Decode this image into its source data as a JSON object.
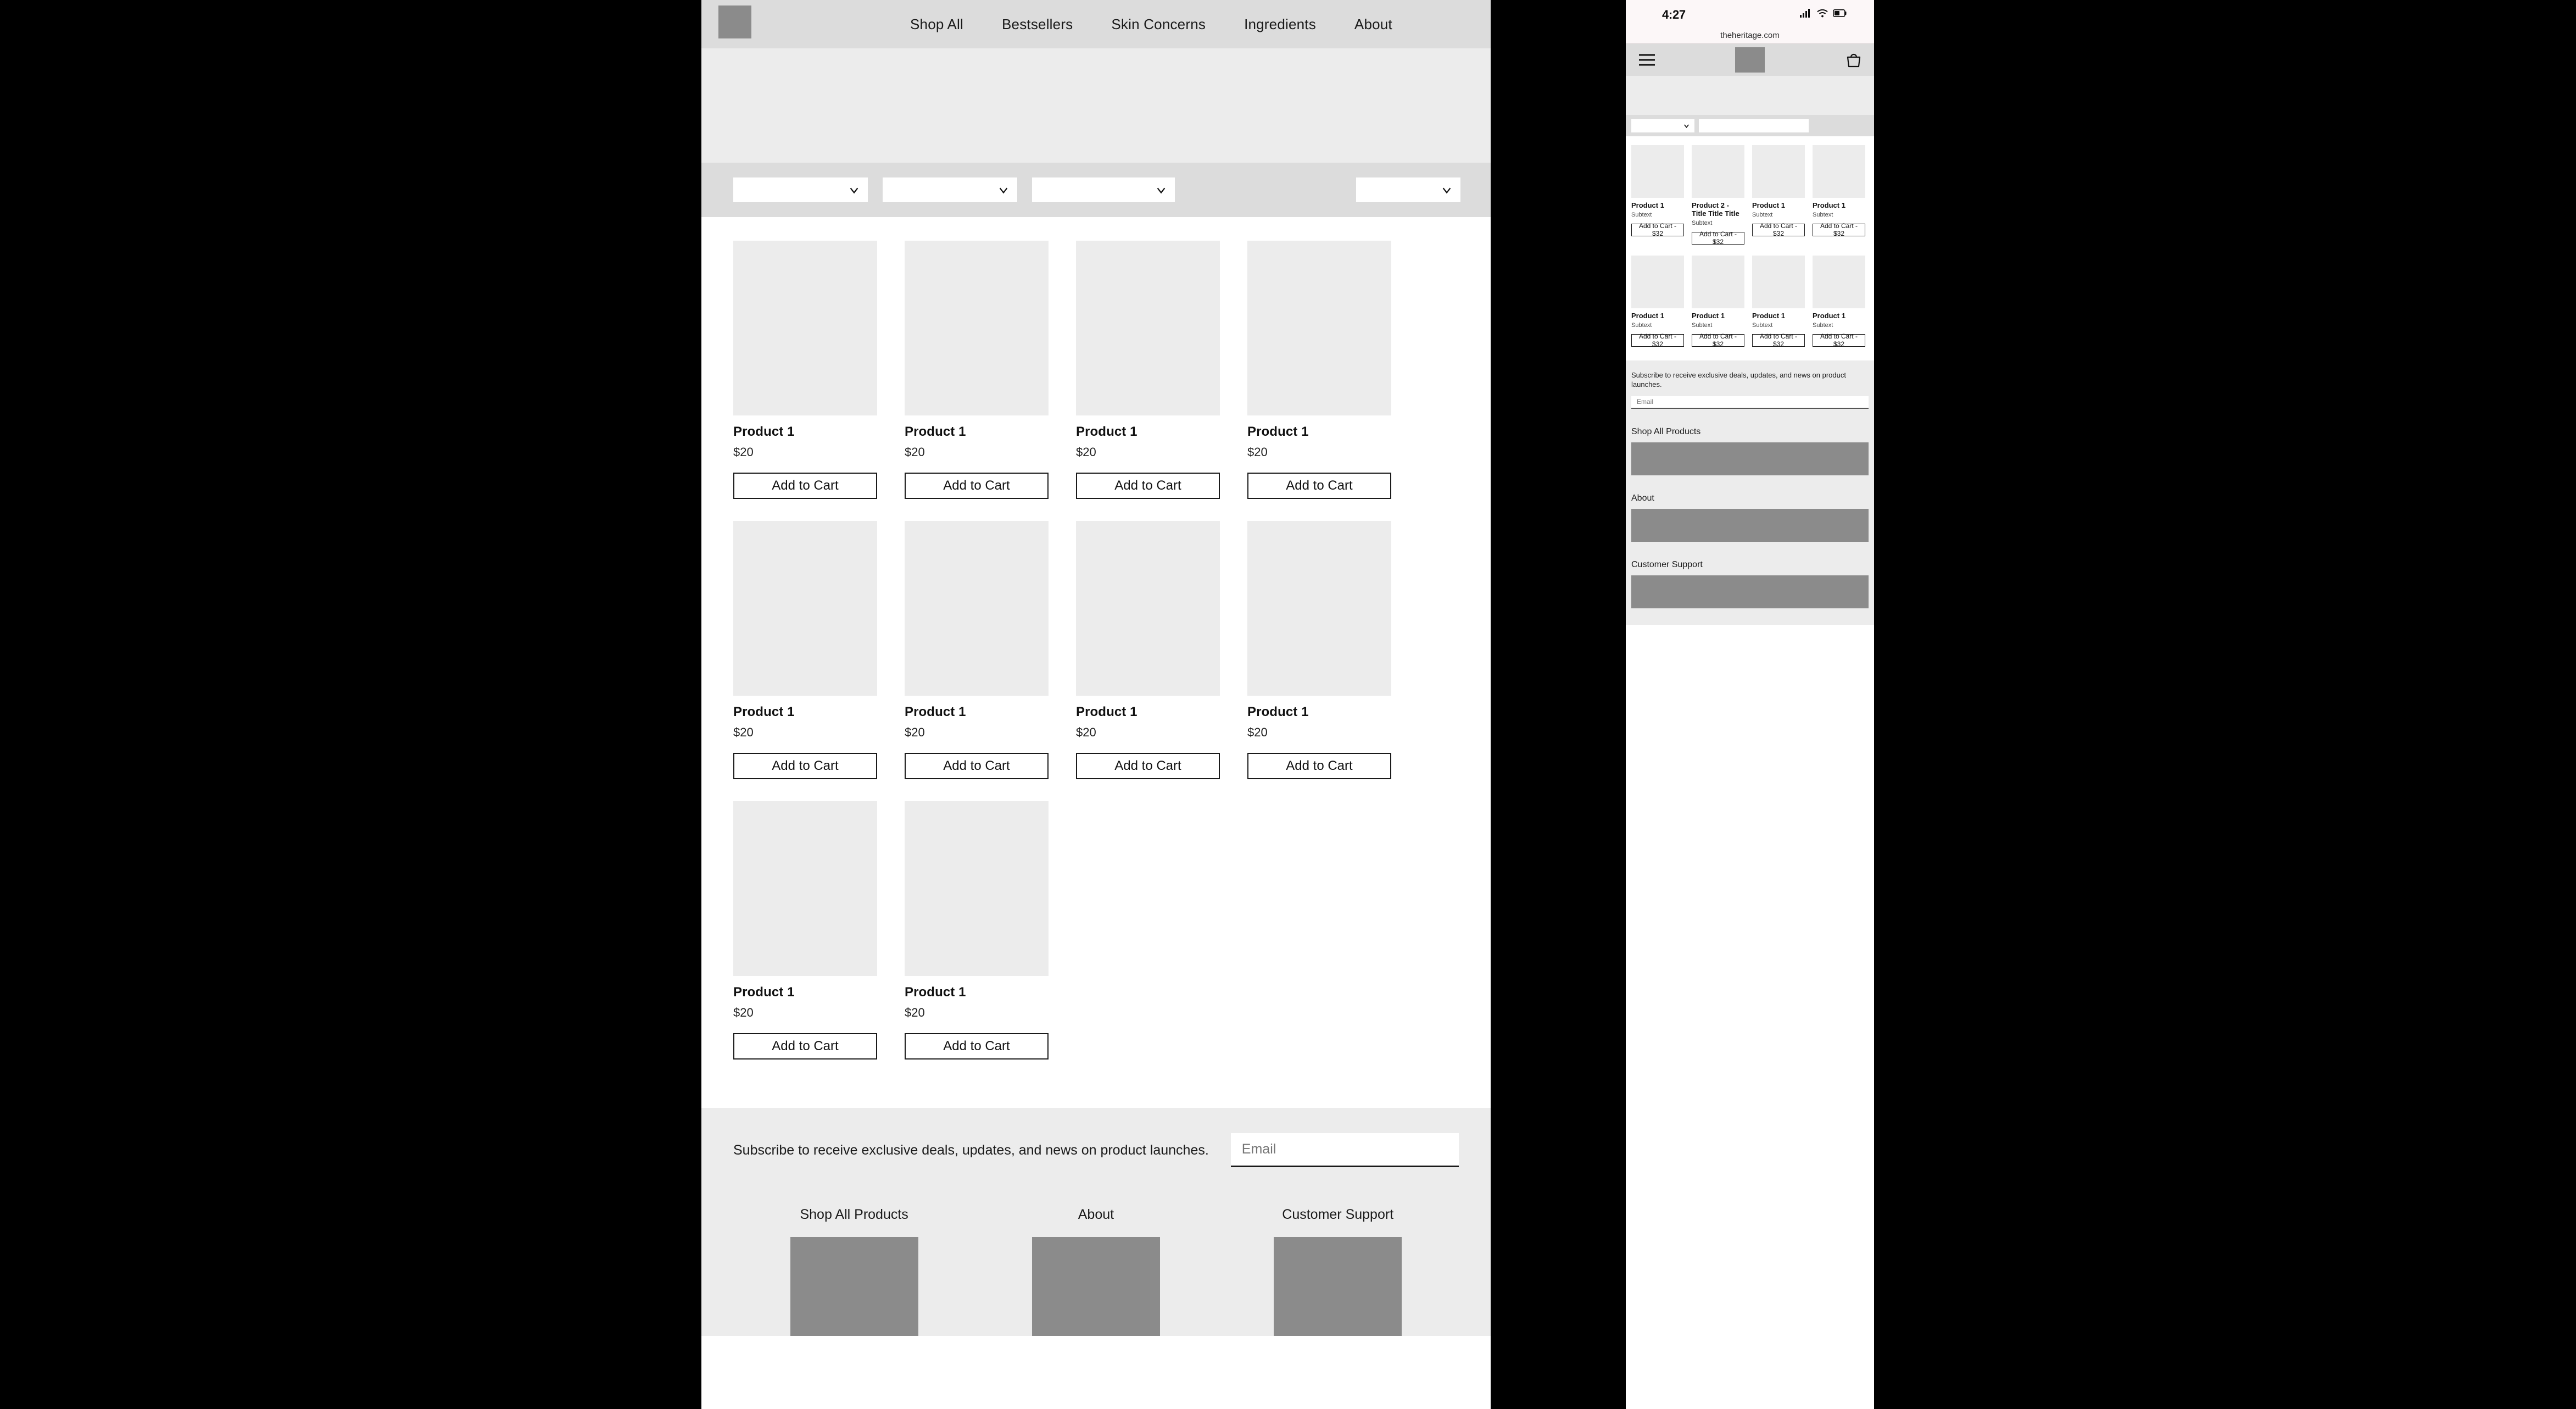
{
  "desktop": {
    "nav": {
      "logo_label": "logo-placeholder",
      "links": [
        {
          "label": "Shop All"
        },
        {
          "label": "Bestsellers"
        },
        {
          "label": "Skin Concerns"
        },
        {
          "label": "Ingredients"
        },
        {
          "label": "About"
        }
      ]
    },
    "filters": [
      {
        "value": "",
        "placeholder": ""
      },
      {
        "value": "",
        "placeholder": ""
      },
      {
        "value": "",
        "placeholder": ""
      },
      {
        "value": "",
        "placeholder": ""
      }
    ],
    "products": [
      {
        "title": "Product 1",
        "price": "$20",
        "cta": "Add to Cart"
      },
      {
        "title": "Product 1",
        "price": "$20",
        "cta": "Add to Cart"
      },
      {
        "title": "Product 1",
        "price": "$20",
        "cta": "Add to Cart"
      },
      {
        "title": "Product 1",
        "price": "$20",
        "cta": "Add to Cart"
      },
      {
        "title": "Product 1",
        "price": "$20",
        "cta": "Add to Cart"
      },
      {
        "title": "Product 1",
        "price": "$20",
        "cta": "Add to Cart"
      },
      {
        "title": "Product 1",
        "price": "$20",
        "cta": "Add to Cart"
      },
      {
        "title": "Product 1",
        "price": "$20",
        "cta": "Add to Cart"
      },
      {
        "title": "Product 1",
        "price": "$20",
        "cta": "Add to Cart"
      },
      {
        "title": "Product 1",
        "price": "$20",
        "cta": "Add to Cart"
      }
    ],
    "footer": {
      "subscribe_text": "Subscribe to receive exclusive deals, updates, and news on product launches.",
      "email_placeholder": "Email",
      "email_value": "",
      "columns": [
        {
          "heading": "Shop All Products"
        },
        {
          "heading": "About"
        },
        {
          "heading": "Customer Support"
        }
      ]
    }
  },
  "mobile": {
    "status": {
      "time": "4:27",
      "signal_icon": "cellular-signal-icon",
      "wifi_icon": "wifi-icon",
      "battery_icon": "battery-icon"
    },
    "url": "theheritage.com",
    "header": {
      "menu_icon": "hamburger-menu-icon",
      "logo_label": "logo-placeholder",
      "cart_icon": "shopping-bag-icon"
    },
    "filters": [
      {
        "value": "",
        "placeholder": ""
      },
      {
        "value": "",
        "placeholder": ""
      }
    ],
    "products": [
      {
        "title": "Product 1",
        "subtext": "Subtext",
        "cta": "Add to Cart - $32"
      },
      {
        "title": "Product 2 - Title Title Title",
        "subtext": "Subtext",
        "cta": "Add to Cart - $32"
      },
      {
        "title": "Product 1",
        "subtext": "Subtext",
        "cta": "Add to Cart - $32"
      },
      {
        "title": "Product 1",
        "subtext": "Subtext",
        "cta": "Add to Cart - $32"
      },
      {
        "title": "Product 1",
        "subtext": "Subtext",
        "cta": "Add to Cart - $32"
      },
      {
        "title": "Product 1",
        "subtext": "Subtext",
        "cta": "Add to Cart - $32"
      },
      {
        "title": "Product 1",
        "subtext": "Subtext",
        "cta": "Add to Cart - $32"
      },
      {
        "title": "Product 1",
        "subtext": "Subtext",
        "cta": "Add to Cart - $32"
      }
    ],
    "footer": {
      "subscribe_text": "Subscribe to receive exclusive deals, updates, and news on product launches.",
      "email_placeholder": "Email",
      "email_value": "",
      "columns": [
        {
          "heading": "Shop All Products"
        },
        {
          "heading": "About"
        },
        {
          "heading": "Customer Support"
        }
      ]
    }
  },
  "colors": {
    "page_background": "#000000",
    "nav_background": "#dcdcdc",
    "hero_background": "#ececec",
    "placeholder_image": "#ececec",
    "footer_block": "#8b8b8b",
    "text": "#1a1a1a",
    "status_bar": "#fcf7f8"
  }
}
